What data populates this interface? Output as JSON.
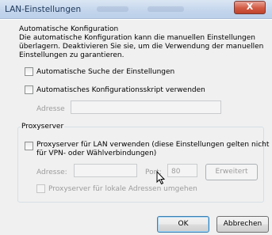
{
  "window": {
    "title": "LAN-Einstellungen",
    "close_glyph": "X"
  },
  "auto_config": {
    "heading": "Automatische Konfiguration",
    "description_lines": [
      "Die automatische Konfiguration kann die manuellen Einstellungen",
      "überlagern. Deaktivieren Sie sie, um die Verwendung der manuellen",
      "Einstellungen zu garantieren."
    ],
    "auto_detect_label": "Automatische Suche der Einstellungen",
    "auto_detect_checked": false,
    "script_label": "Automatisches Konfigurationsskript verwenden",
    "script_checked": false,
    "address_label": "Adresse",
    "address_value": ""
  },
  "proxy": {
    "group_label": "Proxyserver",
    "use_proxy_label_lines": [
      "Proxyserver für LAN verwenden (diese Einstellungen gelten nicht",
      "für VPN- oder Wählverbindungen)"
    ],
    "use_proxy_checked": false,
    "address_label": "Adresse:",
    "address_value": "",
    "port_label": "Port:",
    "port_value": "80",
    "advanced_label": "Erweitert",
    "bypass_label": "Proxyserver für lokale Adressen umgehen",
    "bypass_checked": false
  },
  "buttons": {
    "ok": "OK",
    "cancel": "Abbrechen"
  },
  "colors": {
    "title_text": "#1e395b",
    "close_button": "#d25a43",
    "disabled_text": "#9c9c9c"
  }
}
